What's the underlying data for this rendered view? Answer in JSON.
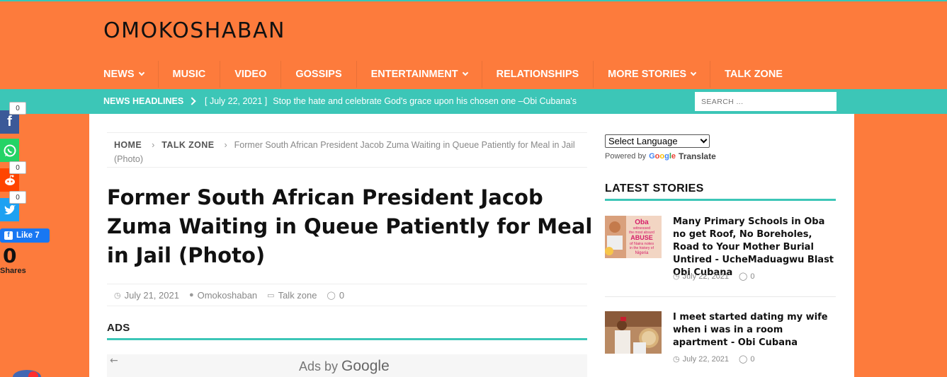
{
  "site": {
    "logo": "OMOKOSHABAN"
  },
  "nav": {
    "items": [
      {
        "label": "NEWS",
        "dropdown": true
      },
      {
        "label": "MUSIC",
        "dropdown": false
      },
      {
        "label": "VIDEO",
        "dropdown": false
      },
      {
        "label": "GOSSIPS",
        "dropdown": false
      },
      {
        "label": "ENTERTAINMENT",
        "dropdown": true
      },
      {
        "label": "RELATIONSHIPS",
        "dropdown": false
      },
      {
        "label": "MORE STORIES",
        "dropdown": true
      },
      {
        "label": "TALK ZONE",
        "dropdown": false
      }
    ]
  },
  "ticker": {
    "label": "NEWS HEADLINES",
    "date": "[ July 22, 2021 ]",
    "text": "Stop the hate and celebrate God's grace upon his chosen one –Obi Cubana's"
  },
  "search": {
    "placeholder": "SEARCH ..."
  },
  "breadcrumb": {
    "home": "HOME",
    "section": "TALK ZONE",
    "current": "Former South African President Jacob Zuma Waiting in Queue Patiently for Meal in Jail (Photo)"
  },
  "article": {
    "title": "Former South African President Jacob Zuma Waiting in Queue Patiently for Meal in Jail (Photo)",
    "date": "July 21, 2021",
    "author": "Omokoshaban",
    "category": "Talk zone",
    "comments": "0"
  },
  "ads": {
    "heading": "ADS",
    "ads_by": "Ads by",
    "google": "Google"
  },
  "sidebar": {
    "language_select": "Select Language",
    "powered_by": "Powered by",
    "google": "Google",
    "translate": "Translate",
    "latest_heading": "LATEST STORIES",
    "stories": [
      {
        "title": "Many Primary Schools in Oba no get Roof, No Boreholes, Road to Your Mother Burial Untired - UcheMaduagwu Blast Obi Cubana",
        "date": "July 22, 2021",
        "comments": "0",
        "thumb_text": [
          "Oba",
          "witnessed",
          "the most absurd",
          "ABUSE",
          "of Naira notes",
          "in the history of",
          "Nigeria"
        ]
      },
      {
        "title": "I meet started dating my wife when i was in a room apartment - Obi Cubana",
        "date": "July 22, 2021",
        "comments": "0"
      }
    ]
  },
  "social": {
    "counts": [
      "0",
      "0",
      "0"
    ],
    "like_label": "Like 7",
    "shares_count": "0",
    "shares_label": "Shares"
  }
}
